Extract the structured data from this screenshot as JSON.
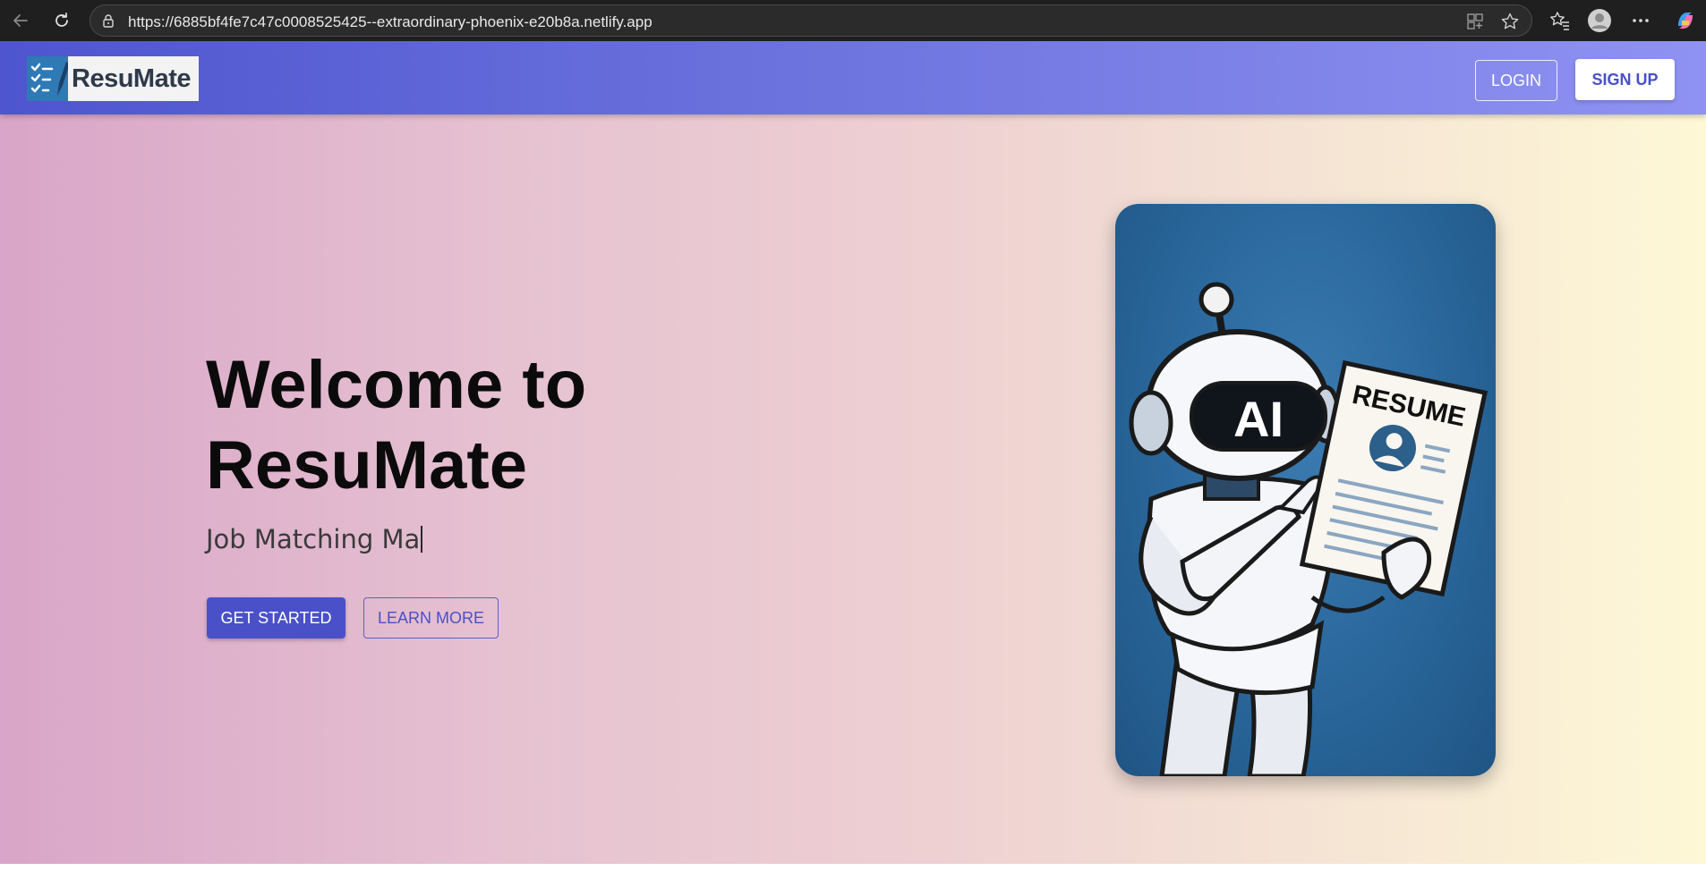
{
  "browser": {
    "url": "https://6885bf4fe7c47c0008525425--extraordinary-phoenix-e20b8a.netlify.app",
    "icons": [
      "back-icon",
      "reload-icon",
      "lock-icon",
      "app-available-icon",
      "favorite-star-icon",
      "favorites-icon",
      "profile-icon",
      "more-icon",
      "copilot-icon"
    ]
  },
  "navbar": {
    "brand": "ResuMate",
    "login_label": "LOGIN",
    "signup_label": "SIGN UP"
  },
  "hero": {
    "title_line1": "Welcome to",
    "title_line2": "ResuMate",
    "subtitle": "Job Matching Ma",
    "get_started_label": "GET STARTED",
    "learn_more_label": "LEARN MORE",
    "illustration": {
      "visor_text": "AI",
      "document_title": "RESUME"
    }
  },
  "colors": {
    "accent": "#4a50c8",
    "navbar_start": "#4e55cf",
    "navbar_end": "#8f92f2",
    "card_blue": "#2c6a9f"
  }
}
